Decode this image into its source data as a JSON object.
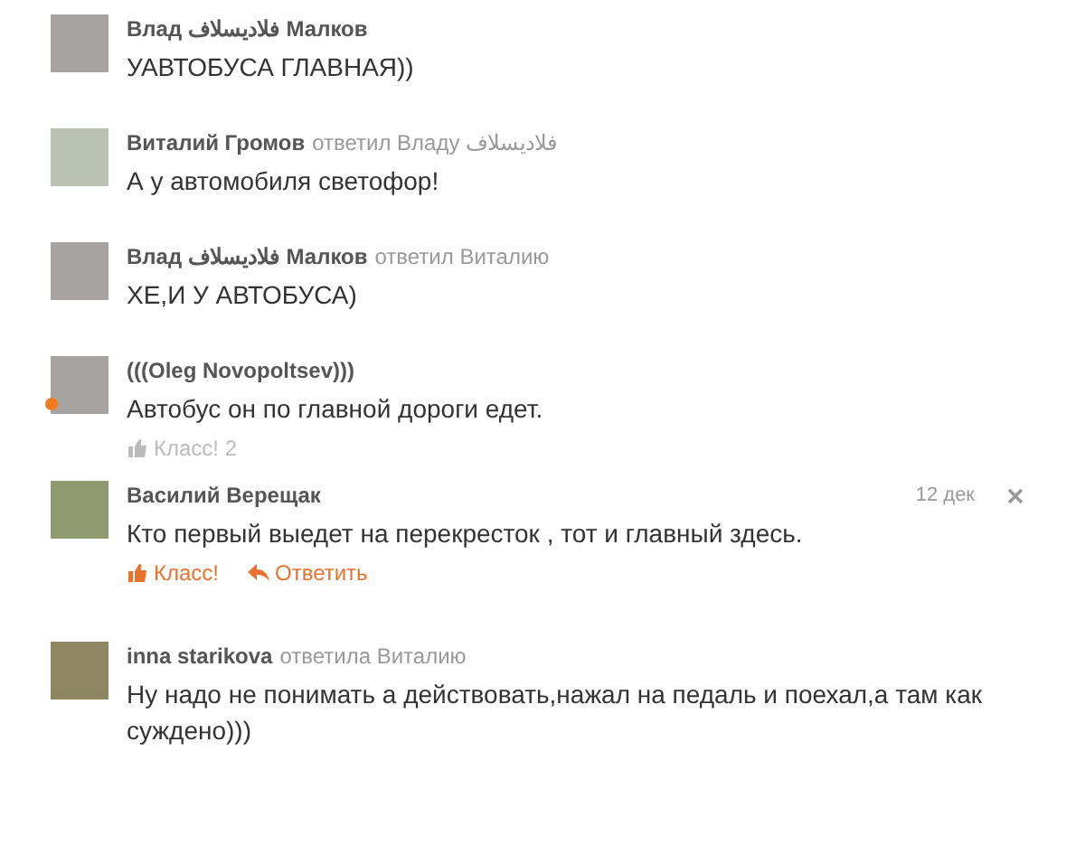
{
  "comments": [
    {
      "author": "Влад فلاديسلاف Малков",
      "text": "УАВТОБУСА ГЛАВНАЯ))",
      "online": false
    },
    {
      "author": "Виталий Громов",
      "reply_to": "ответил Владу فلاديسلاف",
      "text": "А у автомобиля светофор!",
      "online": false
    },
    {
      "author": "Влад فلاديسلاف Малков",
      "reply_to": "ответил Виталию",
      "text": "ХЕ,И У АВТОБУСА)",
      "online": false
    },
    {
      "author": "(((Oleg Novopoltsev)))",
      "text": "Автобус он по главной дороги едет.",
      "online": true,
      "actions": [
        {
          "kind": "like",
          "label": "Класс! 2",
          "highlighted": false
        }
      ]
    },
    {
      "author": "Василий Верещак",
      "date": "12 дек",
      "text": "Кто первый выедет на перекресток , тот и главный здесь.",
      "online": false,
      "actions": [
        {
          "kind": "like",
          "label": "Класс!",
          "highlighted": true
        },
        {
          "kind": "reply",
          "label": "Ответить",
          "highlighted": true
        }
      ]
    },
    {
      "author": "inna starikova",
      "reply_to": "ответила Виталию",
      "text": "Ну надо не понимать а действовать,нажал на педаль и поехал,а там как суждено)))",
      "online": false
    }
  ]
}
